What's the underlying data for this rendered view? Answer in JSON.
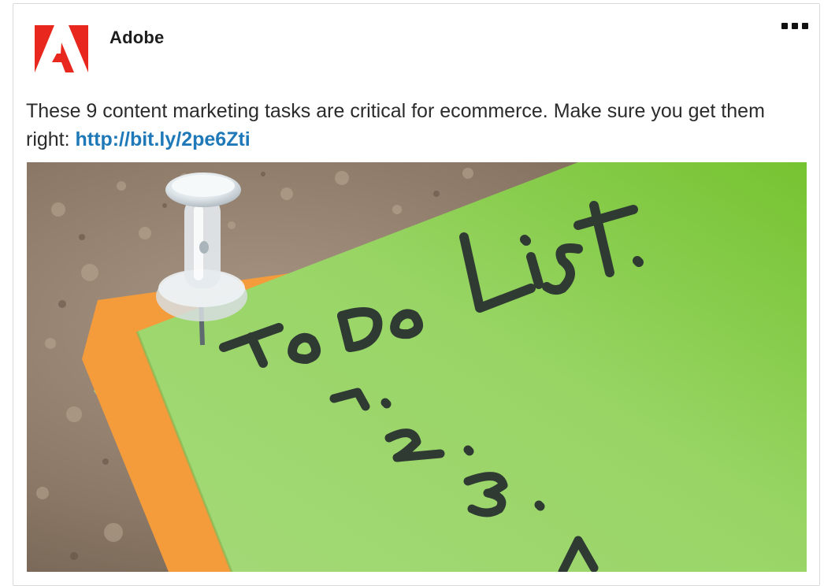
{
  "post": {
    "author": "Adobe",
    "text": "These 9 content marketing tasks are critical for ecommerce. Make sure you get them right: ",
    "link": "http://bit.ly/2pe6Zti",
    "more_icon": "more-horizontal-icon"
  },
  "image": {
    "handwriting": "To Do List.",
    "list_numbers": [
      "1.",
      "2.",
      "3."
    ],
    "note_color": "#9fd86a",
    "orange_color": "#f7a24a",
    "cork_color": "#8e7b69"
  },
  "brand": {
    "logo_color": "#e8281e"
  }
}
